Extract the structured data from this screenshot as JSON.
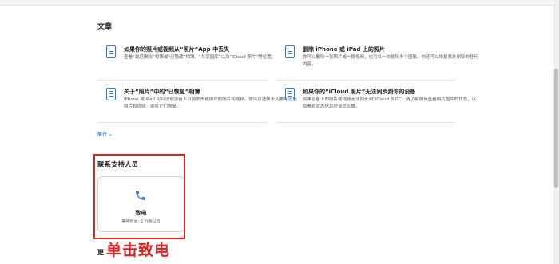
{
  "articles_section": {
    "title": "文章",
    "articles": [
      {
        "title": "如果你的照片或视频从“照片”App 中丢失",
        "desc": "查看“最近删除”相簿或“已隐藏”相簿、“共享图库”以及“iCloud 照片”等位置。"
      },
      {
        "title": "删除 iPhone 或 iPad 上的照片",
        "desc": "你可以删除一张照片或一段视频，也可以一次删除多个图像。你还可以恢复意外删除的任何内容。"
      },
      {
        "title": "关于“照片”中的“已恢复”相簿",
        "desc": "iPhone 或 iPad 可以识别设备上以前丢失或损坏的照片和视频。你可以选择永久删除这些照片和视频，或将它们恢复..."
      },
      {
        "title": "如果你的“iCloud 照片”无法同步到你的设备",
        "desc": "如果设备上的照片或视频无法同步到“iCloud 照片”，请了解如何查看照片图库的状态，以及看到状态信息时该怎么做。"
      }
    ],
    "expand_label": "展开 ⌄"
  },
  "contact": {
    "title": "联系支持人员",
    "call": {
      "label": "致电",
      "wait": "等待时间: 2 分钟以内"
    }
  },
  "more_prefix": "更",
  "annotation": "单击致电",
  "colors": {
    "link": "#0066cc",
    "annotation_red": "#e52222"
  }
}
